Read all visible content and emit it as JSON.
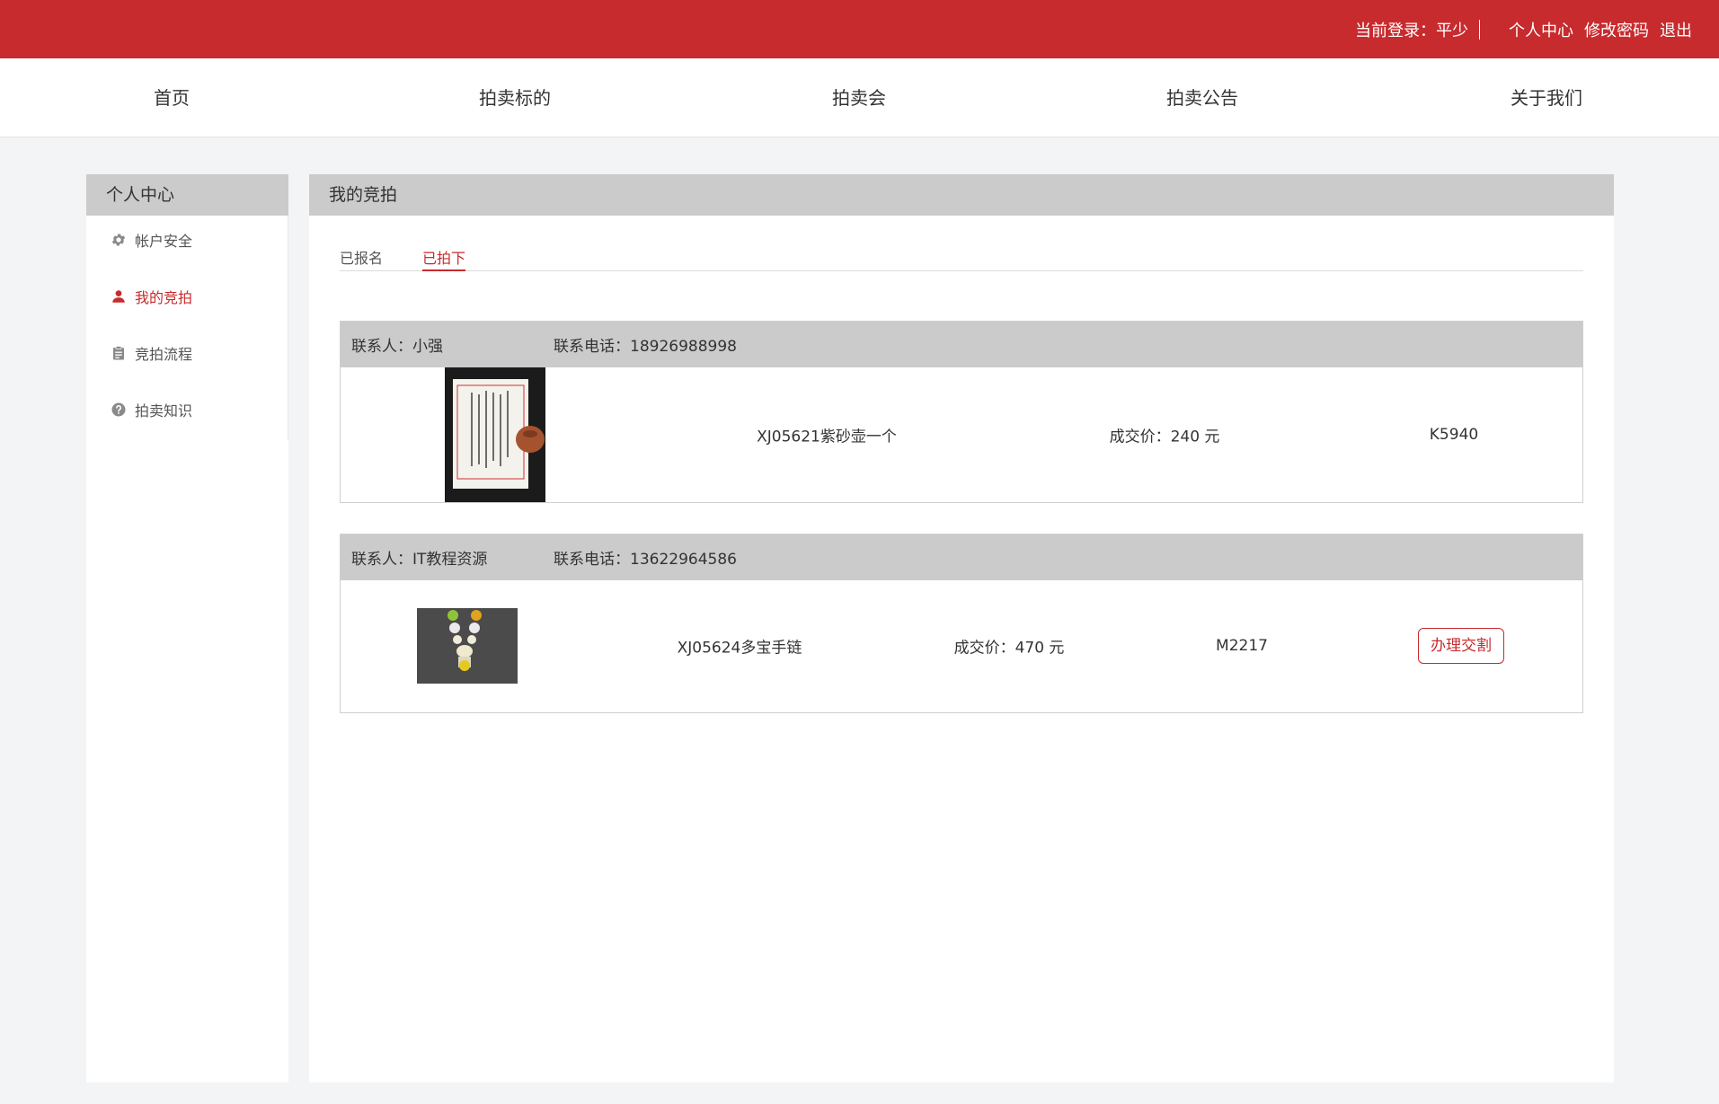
{
  "topbar": {
    "login_label": "当前登录：平少",
    "links": [
      "个人中心",
      "修改密码",
      "退出"
    ]
  },
  "nav": [
    "首页",
    "拍卖标的",
    "拍卖会",
    "拍卖公告",
    "关于我们"
  ],
  "sidebar": {
    "title": "个人中心",
    "items": [
      {
        "label": "帐户安全",
        "icon": "gear-icon",
        "active": false
      },
      {
        "label": "我的竞拍",
        "icon": "user-icon",
        "active": true
      },
      {
        "label": "竞拍流程",
        "icon": "clipboard-icon",
        "active": false
      },
      {
        "label": "拍卖知识",
        "icon": "question-icon",
        "active": false
      }
    ]
  },
  "main": {
    "title": "我的竞拍",
    "tabs": [
      {
        "label": "已报名",
        "active": false
      },
      {
        "label": "已拍下",
        "active": true
      }
    ]
  },
  "orders": [
    {
      "contact": "联系人：小强",
      "phone": "联系电话：18926988998",
      "item_name": "XJ05621紫砂壶一个",
      "price": "成交价：240 元",
      "code": "K5940",
      "action": ""
    },
    {
      "contact": "联系人：IT教程资源",
      "phone": "联系电话：13622964586",
      "item_name": "XJ05624多宝手链",
      "price": "成交价：470 元",
      "code": "M2217",
      "action": "办理交割"
    }
  ],
  "colors": {
    "accent": "#c72b2e",
    "header_gray": "#cbcbcb",
    "page_bg": "#f3f4f6"
  }
}
